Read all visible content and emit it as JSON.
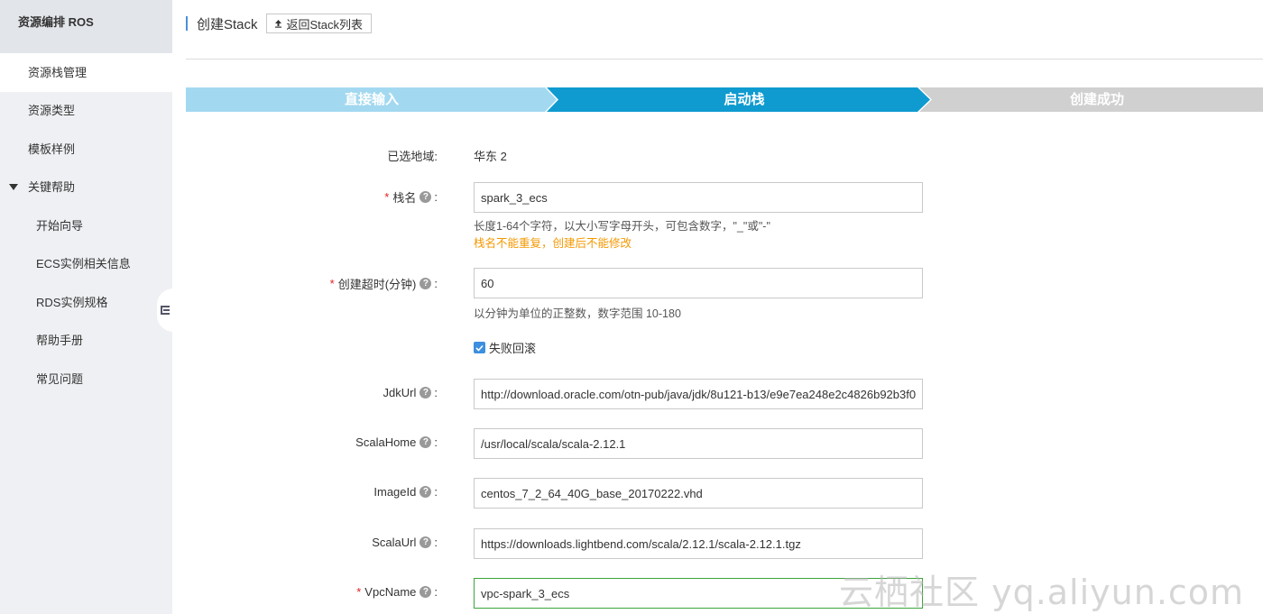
{
  "sidebar": {
    "header": "资源编排 ROS",
    "items": [
      {
        "label": "资源栈管理"
      },
      {
        "label": "资源类型"
      },
      {
        "label": "模板样例"
      },
      {
        "label": "关键帮助"
      },
      {
        "label": "开始向导"
      },
      {
        "label": "ECS实例相关信息"
      },
      {
        "label": "RDS实例规格"
      },
      {
        "label": "帮助手册"
      },
      {
        "label": "常见问题"
      }
    ]
  },
  "header": {
    "title": "创建Stack",
    "back_button": "返回Stack列表"
  },
  "stepper": {
    "steps": [
      "直接输入",
      "启动栈",
      "创建成功"
    ],
    "colors": {
      "done": "#a3d9f0",
      "active": "#0f9bd0",
      "pending": "#d0d0d0"
    }
  },
  "form": {
    "region": {
      "label": "已选地域:",
      "value": "华东 2"
    },
    "stack_name": {
      "label": "栈名",
      "value": "spark_3_ecs",
      "hint": "长度1-64个字符，以大小写字母开头，可包含数字，\"_\"或\"-\"",
      "warning": "栈名不能重复，创建后不能修改"
    },
    "timeout": {
      "label": "创建超时(分钟)",
      "value": "60",
      "hint": "以分钟为单位的正整数，数字范围 10-180"
    },
    "rollback": {
      "label": "失败回滚",
      "checked": true
    },
    "jdk_url": {
      "label": "JdkUrl",
      "value": "http://download.oracle.com/otn-pub/java/jdk/8u121-b13/e9e7ea248e2c4826b92b3f0"
    },
    "scala_home": {
      "label": "ScalaHome",
      "value": "/usr/local/scala/scala-2.12.1"
    },
    "image_id": {
      "label": "ImageId",
      "value": "centos_7_2_64_40G_base_20170222.vhd"
    },
    "scala_url": {
      "label": "ScalaUrl",
      "value": "https://downloads.lightbend.com/scala/2.12.1/scala-2.12.1.tgz"
    },
    "vpc_name": {
      "label": "VpcName",
      "value": "vpc-spark_3_ecs"
    }
  },
  "watermark": "云栖社区 yq.aliyun.com"
}
